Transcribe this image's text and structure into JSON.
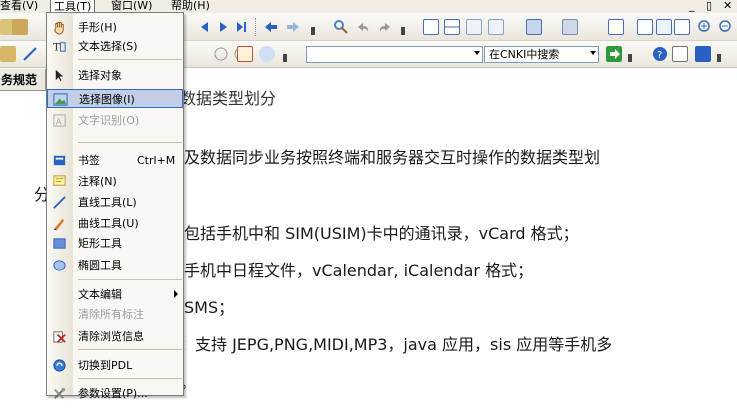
{
  "menubar": {
    "items": [
      {
        "label": "查看(V)"
      },
      {
        "label": "工具(T)"
      },
      {
        "label": "窗口(W)"
      },
      {
        "label": "帮助(H)"
      }
    ],
    "window_controls": [
      "_",
      "▯",
      "✕"
    ]
  },
  "toolbar": {
    "search_combo": "",
    "search_engine": "在CNKI中搜索"
  },
  "left_panel": {
    "tab_label": "务规范"
  },
  "tools_menu": {
    "items": [
      {
        "label": "手形(H)",
        "icon": "hand-icon",
        "state": "normal"
      },
      {
        "label": "文本选择(S)",
        "icon": "text-select-icon",
        "state": "normal"
      },
      {
        "label": "选择对象",
        "icon": "select-arrow-icon",
        "state": "normal"
      },
      {
        "label": "选择图像(I)",
        "icon": "select-image-icon",
        "state": "highlighted"
      },
      {
        "label": "文字识别(O)",
        "icon": "ocr-icon",
        "state": "disabled"
      },
      {
        "label": "书签",
        "shortcut": "Ctrl+M",
        "icon": "bookmark-icon",
        "state": "normal"
      },
      {
        "label": "注释(N)",
        "icon": "annotation-icon",
        "state": "normal"
      },
      {
        "label": "直线工具(L)",
        "icon": "line-tool-icon",
        "state": "normal"
      },
      {
        "label": "曲线工具(U)",
        "icon": "curve-tool-icon",
        "state": "normal"
      },
      {
        "label": "矩形工具",
        "icon": "rectangle-tool-icon",
        "state": "normal"
      },
      {
        "label": "椭圆工具",
        "icon": "ellipse-tool-icon",
        "state": "normal"
      },
      {
        "label": "文本编辑",
        "icon": "",
        "state": "submenu"
      },
      {
        "label": "清除所有标注",
        "icon": "",
        "state": "disabled"
      },
      {
        "label": "清除浏览信息",
        "icon": "clear-history-icon",
        "state": "normal"
      },
      {
        "label": "切换到PDL",
        "icon": "switch-pdl-icon",
        "state": "normal"
      },
      {
        "label": "参数设置(P)...",
        "icon": "settings-icon",
        "state": "normal"
      }
    ]
  },
  "document": {
    "lines": [
      "数据类型划分",
      "及数据同步业务按照终端和服务器交互时操作的数据类型划",
      "分",
      "包括手机中和 SIM(USIM)卡中的通讯录，vCard 格式；",
      "手机中日程文件，vCalendar, iCalendar 格式；",
      "SMS；",
      "：支持 JEPG,PNG,MIDI,MP3，java 应用，sis 应用等手机多",
      "。"
    ]
  }
}
